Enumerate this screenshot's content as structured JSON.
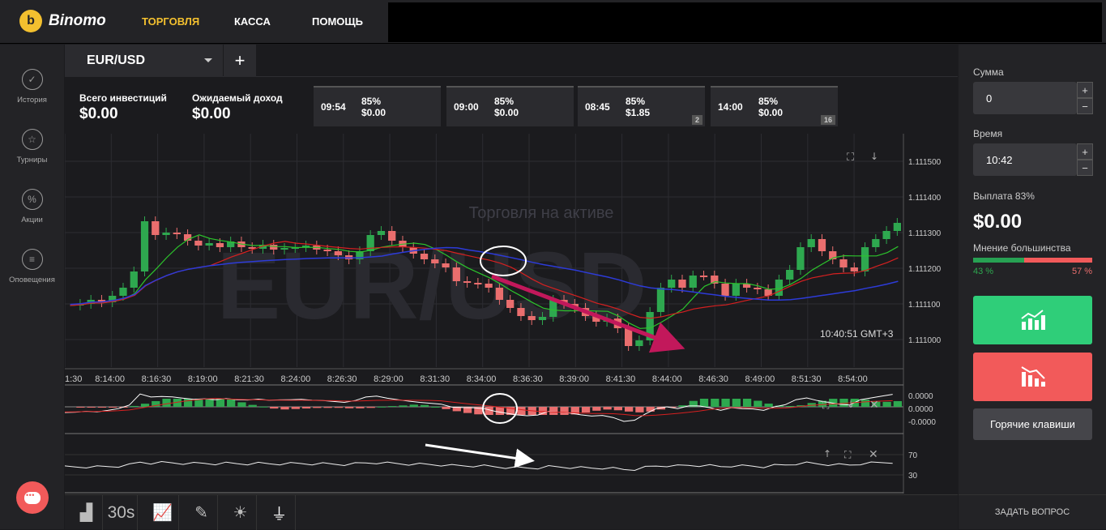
{
  "brand": {
    "name": "Binomo"
  },
  "nav": {
    "trade": "ТОРГОВЛЯ",
    "cashier": "КАССА",
    "help": "ПОМОЩЬ"
  },
  "sidebar": {
    "items": [
      {
        "label": "История",
        "icon": "check-circle-icon"
      },
      {
        "label": "Турниры",
        "icon": "trophy-icon"
      },
      {
        "label": "Акции",
        "icon": "percent-icon"
      },
      {
        "label": "Оповещения",
        "icon": "list-icon"
      }
    ]
  },
  "tab": {
    "asset": "EUR/USD",
    "add": "+"
  },
  "investment": {
    "total_label": "Всего инвестиций",
    "total_value": "$0.00",
    "expected_label": "Ожидаемый доход",
    "expected_value": "$0.00"
  },
  "expirations": [
    {
      "time": "09:54",
      "percent": "85%",
      "amount": "$0.00",
      "badge": ""
    },
    {
      "time": "09:00",
      "percent": "85%",
      "amount": "$0.00",
      "badge": ""
    },
    {
      "time": "08:45",
      "percent": "85%",
      "amount": "$1.85",
      "badge": "2"
    },
    {
      "time": "14:00",
      "percent": "85%",
      "amount": "$0.00",
      "badge": "16"
    }
  ],
  "chart": {
    "watermark": "EUR/USD",
    "active_trading": "Торговля на активе",
    "clock": "10:40:51 GMT+3",
    "price_ticks": [
      "1.111500",
      "1.111400",
      "1.111300",
      "1.111200",
      "1.111100",
      "1.111000"
    ],
    "time_ticks": [
      "1:30",
      "8:14:00",
      "8:16:30",
      "8:19:00",
      "8:21:30",
      "8:24:00",
      "8:26:30",
      "8:29:00",
      "8:31:30",
      "8:34:00",
      "8:36:30",
      "8:39:00",
      "8:41:30",
      "8:44:00",
      "8:46:30",
      "8:49:00",
      "8:51:30",
      "8:54:00"
    ],
    "macd_ticks": [
      "0.0000",
      "0.0000",
      "-0.0000"
    ],
    "rsi_ticks": [
      "70",
      "30"
    ],
    "colors": {
      "up": "#2ea84f",
      "down": "#ea6e6e",
      "ma_green": "#2cc42c",
      "ma_red": "#d62020",
      "ma_blue": "#2d3bd8",
      "ma_purple": "#b52fd1",
      "arrow": "#c2185b"
    }
  },
  "right_panel": {
    "sum_label": "Сумма",
    "sum_value": "0",
    "time_label": "Время",
    "time_value": "10:42",
    "payout_label": "Выплата 83%",
    "payout_value": "$0.00",
    "majority_label": "Мнение большинства",
    "majority_up": "43 %",
    "majority_down": "57 %",
    "majority_up_fraction": 0.43,
    "hotkeys": "Горячие клавиши",
    "plus": "+",
    "minus": "−"
  },
  "bottom": {
    "timeframe": "30s",
    "ask": "ЗАДАТЬ ВОПРОС"
  }
}
